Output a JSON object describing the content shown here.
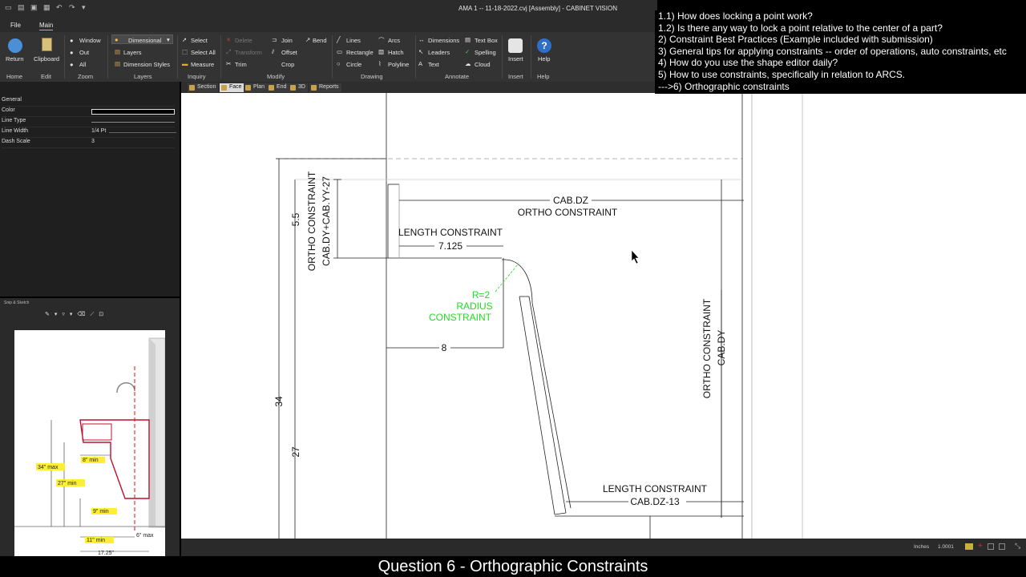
{
  "window": {
    "title": "AMA 1 -- 11-18-2022.cvj [Assembly] - CABINET VISION"
  },
  "menu": {
    "tabs": [
      "File",
      "Main"
    ]
  },
  "ribbon": {
    "return": "Return",
    "clipboard": "Clipboard",
    "zoom_window": "Window",
    "zoom_out": "Out",
    "zoom_all": "All",
    "dimensional": "Dimensional",
    "layers": "Layers",
    "dimension_styles": "Dimension Styles",
    "select": "Select",
    "select_all": "Select All",
    "measure": "Measure",
    "delete": "Delete",
    "transform": "Transform",
    "trim": "Trim",
    "join": "Join",
    "bend": "Bend",
    "offset": "Offset",
    "crop": "Crop",
    "lines": "Lines",
    "rectangle": "Rectangle",
    "circle": "Circle",
    "arcs": "Arcs",
    "hatch": "Hatch",
    "polyline": "Polyline",
    "dimensions": "Dimensions",
    "leaders": "Leaders",
    "text": "Text",
    "text_box": "Text Box",
    "spelling": "Spelling",
    "cloud": "Cloud",
    "insert": "Insert",
    "help": "Help",
    "groups": {
      "home": "Home",
      "edit": "Edit",
      "zoom": "Zoom",
      "layers": "Layers",
      "inquiry": "Inquiry",
      "modify": "Modify",
      "drawing": "Drawing",
      "annotate": "Annotate",
      "insert": "Insert",
      "help": "Help"
    }
  },
  "view_tabs": [
    "Section",
    "Face",
    "Plan",
    "End",
    "3D",
    "Reports"
  ],
  "properties": {
    "general": "General",
    "color": "Color",
    "line_type": "Line Type",
    "line_width": "Line Width",
    "line_width_value": "1/4 Pt",
    "dash_scale": "Dash Scale",
    "dash_scale_value": "3"
  },
  "snip": {
    "title": "Snip & Sketch",
    "labels": {
      "max34": "34\" max",
      "min8": "8\" min",
      "min27": "27\" min",
      "min9": "9\" min",
      "min11": "11\" min",
      "max6": "6\" max",
      "w1725": "17.25\""
    }
  },
  "drawing": {
    "cab_dz": "CAB.DZ",
    "ortho_constraint_top": "ORTHO CONSTRAINT",
    "length_constraint_1": "LENGTH CONSTRAINT",
    "dim_7125": "7.125",
    "dim_8": "8",
    "radius_r": "R=2",
    "radius_label": "RADIUS",
    "radius_constraint": "CONSTRAINT",
    "dim_55": "5.5",
    "ortho_left_1": "ORTHO CONSTRAINT",
    "ortho_left_2": "CAB.DY+CAB.YY-27",
    "dim_34": "34",
    "dim_27": "27",
    "ortho_right_1": "ORTHO CONSTRAINT",
    "ortho_right_2": "CAB.DY",
    "length_constraint_2": "LENGTH CONSTRAINT",
    "cab_dz_13": "CAB.DZ-13"
  },
  "status": {
    "units": "Inches",
    "scale": "1.0001"
  },
  "notes": [
    "1.1) How does locking a point work?",
    "1.2) Is there any way to lock a point relative to the center of a part?",
    "2) Constraint Best Practices (Example included with submission)",
    "3) General tips for applying constraints -- order of operations, auto constraints, etc",
    "4) How do you use the shape editor daily?",
    "5) How to use constraints, specifically in relation to ARCS.",
    "--->6) Orthographic constraints"
  ],
  "caption": "Question 6 - Orthographic Constraints",
  "colors": {
    "constraint_green": "#22dd22",
    "ui_dark": "#333333",
    "canvas": "#ffffff"
  }
}
